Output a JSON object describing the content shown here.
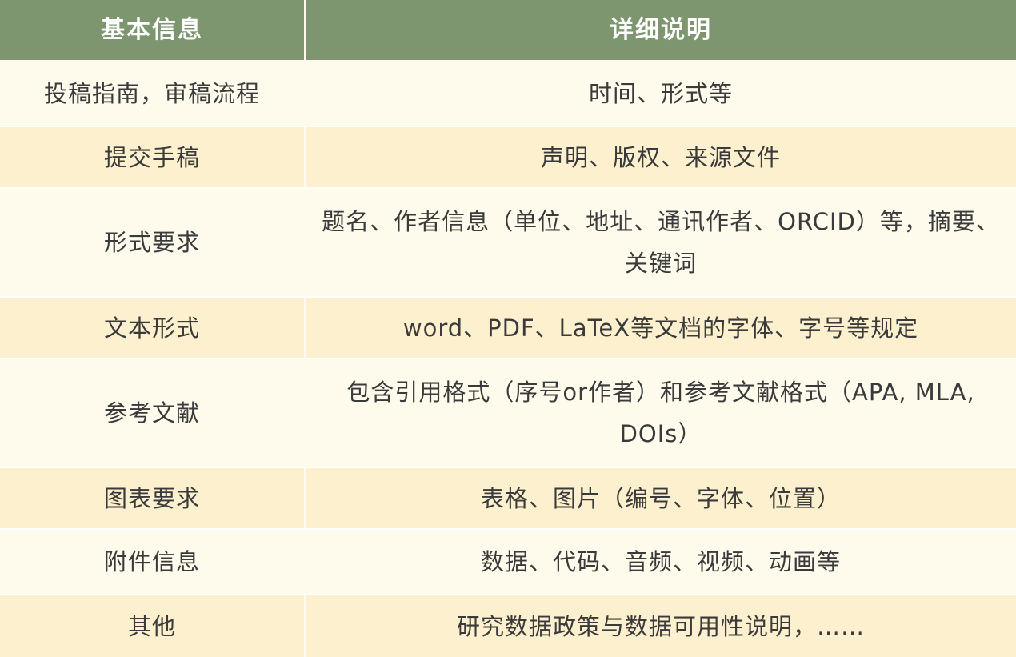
{
  "table": {
    "headers": [
      "基本信息",
      "详细说明"
    ],
    "rows": [
      {
        "label": "投稿指南，审稿流程",
        "detail": "时间、形式等"
      },
      {
        "label": "提交手稿",
        "detail": "声明、版权、来源文件"
      },
      {
        "label": "形式要求",
        "detail": "题名、作者信息（单位、地址、通讯作者、ORCID）等，摘要、关键词"
      },
      {
        "label": "文本形式",
        "detail": "word、PDF、LaTeX等文档的字体、字号等规定"
      },
      {
        "label": "参考文献",
        "detail": "包含引用格式（序号or作者）和参考文献格式（APA, MLA, DOIs）"
      },
      {
        "label": "图表要求",
        "detail": "表格、图片（编号、字体、位置）"
      },
      {
        "label": "附件信息",
        "detail": "数据、代码、音频、视频、动画等"
      },
      {
        "label": "其他",
        "detail": "研究数据政策与数据可用性说明，……"
      }
    ]
  },
  "colors": {
    "header_bg": "#7d9670",
    "header_text": "#ffffff",
    "row_light": "#fefaec",
    "row_dark": "#fdf0ce",
    "text": "#3a3a3a"
  }
}
